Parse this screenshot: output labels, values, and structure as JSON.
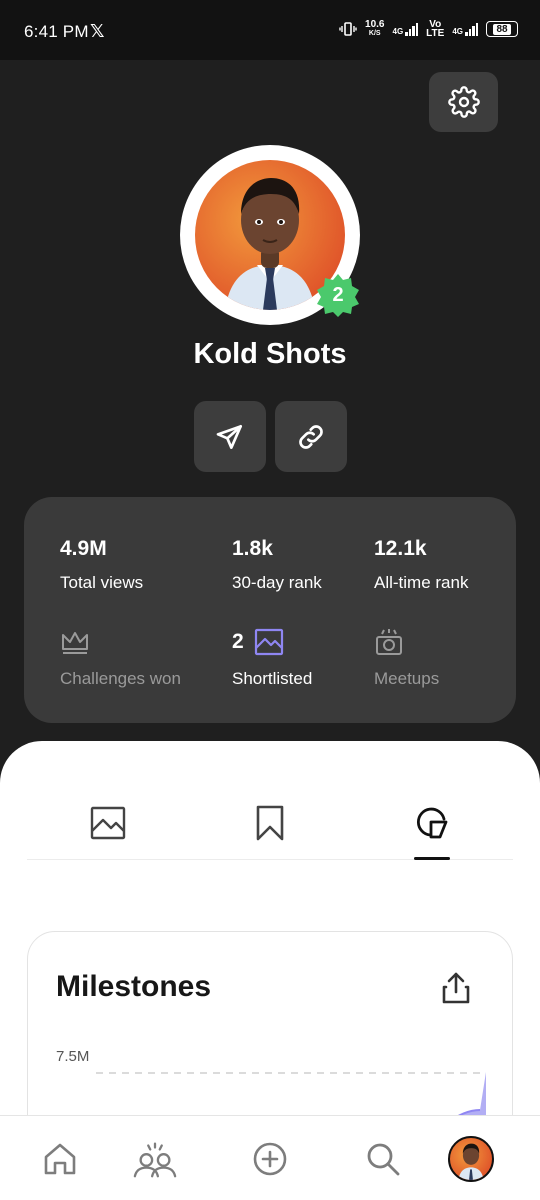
{
  "status_bar": {
    "time": "6:41 PM",
    "x_logo": "𝕏",
    "net_speed_value": "10.6",
    "net_speed_unit": "K/S",
    "sim1_type": "4G",
    "volte_top": "Vo",
    "volte_bottom": "LTE",
    "sim2_type": "4G",
    "battery_level": "88"
  },
  "profile": {
    "name": "Kold Shots",
    "level_badge": "2"
  },
  "stats": {
    "total_views_value": "4.9M",
    "total_views_label": "Total views",
    "rank_30_value": "1.8k",
    "rank_30_label": "30-day rank",
    "alltime_value": "12.1k",
    "alltime_label": "All-time rank",
    "challenges_label": "Challenges won",
    "shortlisted_count": "2",
    "shortlisted_label": "Shortlisted",
    "meetups_label": "Meetups"
  },
  "tabs": [
    {
      "icon": "image-icon"
    },
    {
      "icon": "bookmark-icon"
    },
    {
      "icon": "milestones-icon",
      "active": true
    }
  ],
  "milestones": {
    "title": "Milestones",
    "tick_label": "7.5M"
  },
  "colors": {
    "background": "#1f1f1f",
    "card": "#3a3a3a",
    "accent_purple": "#8f86f2",
    "badge_green": "#4bc96c"
  }
}
